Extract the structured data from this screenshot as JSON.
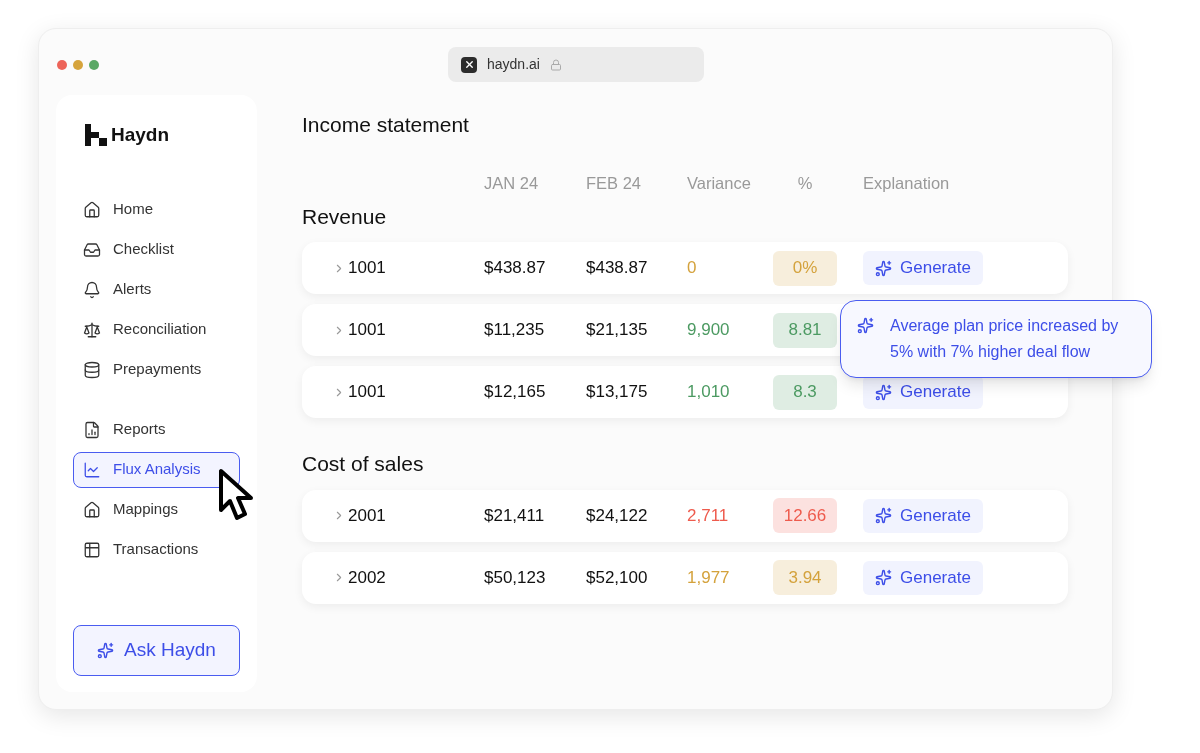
{
  "browser": {
    "url": "haydn.ai"
  },
  "sidebar": {
    "logo": "Haydn",
    "groups": [
      {
        "items": [
          {
            "label": "Home",
            "selected": false
          },
          {
            "label": "Checklist",
            "selected": false
          },
          {
            "label": "Alerts",
            "selected": false
          },
          {
            "label": "Reconciliation",
            "selected": false
          },
          {
            "label": "Prepayments",
            "selected": false
          }
        ]
      },
      {
        "items": [
          {
            "label": "Reports",
            "selected": false
          },
          {
            "label": "Flux Analysis",
            "selected": true
          },
          {
            "label": "Mappings",
            "selected": false
          },
          {
            "label": "Transactions",
            "selected": false
          }
        ]
      }
    ],
    "ask_button": "Ask Haydn"
  },
  "title": "Income statement",
  "columns": [
    "JAN 24",
    "FEB 24",
    "Variance",
    "%",
    "Explanation"
  ],
  "sections": [
    {
      "title": "Revenue",
      "rows": [
        {
          "account": "1001",
          "jan": "$438.87",
          "feb": "$438.87",
          "variance": "0",
          "percent": "0%",
          "color": "#d4a23c",
          "explanation": {
            "kind": "button",
            "label": "Generate"
          }
        },
        {
          "account": "1001",
          "jan": "$11,235",
          "feb": "$21,135",
          "variance": "9,900",
          "percent": "8.81",
          "color": "#4c9a62",
          "explanation": {
            "kind": "tooltip",
            "text": "Average plan price increased by 5% with 7% higher deal flow"
          }
        },
        {
          "account": "1001",
          "jan": "$12,165",
          "feb": "$13,175",
          "variance": "1,010",
          "percent": "8.3",
          "color": "#4c9a62",
          "explanation": {
            "kind": "button",
            "label": "Generate"
          }
        }
      ]
    },
    {
      "title": "Cost of sales",
      "rows": [
        {
          "account": "2001",
          "jan": "$21,411",
          "feb": "$24,122",
          "variance": "2,711",
          "percent": "12.66",
          "color": "#ee5b4d",
          "explanation": {
            "kind": "button",
            "label": "Generate"
          }
        },
        {
          "account": "2002",
          "jan": "$50,123",
          "feb": "$52,100",
          "variance": "1,977",
          "percent": "3.94",
          "color": "#d4a23c",
          "explanation": {
            "kind": "button",
            "label": "Generate"
          }
        }
      ]
    }
  ]
}
